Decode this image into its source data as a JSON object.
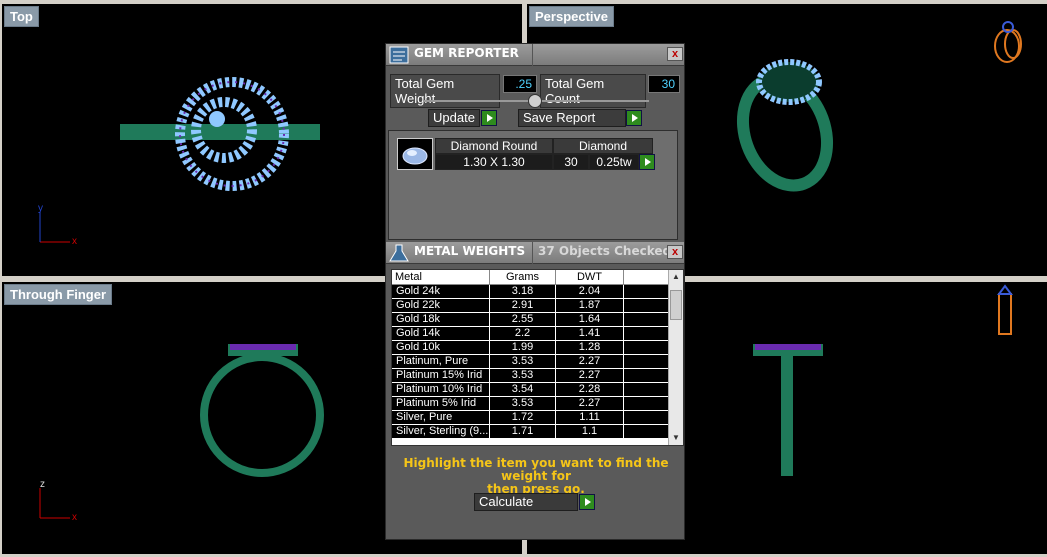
{
  "viewports": {
    "top": {
      "label": "Top"
    },
    "perspective": {
      "label": "Perspective"
    },
    "through_finger": {
      "label": "Through Finger"
    }
  },
  "gem_reporter": {
    "title": "GEM REPORTER",
    "close": "x",
    "total_weight_label": "Total Gem Weight",
    "total_weight_value": ".25",
    "total_count_label": "Total Gem Count",
    "total_count_value": "30",
    "update_label": "Update",
    "save_report_label": "Save Report",
    "gem": {
      "cut": "Diamond Round",
      "size": "1.30 X 1.30",
      "type": "Diamond",
      "count": "30",
      "weight": "0.25tw"
    }
  },
  "metal_weights": {
    "title": "METAL WEIGHTS",
    "status": "37 Objects Checked",
    "close": "x",
    "columns": [
      "Metal",
      "Grams",
      "DWT"
    ],
    "rows": [
      [
        "Gold 24k",
        "3.18",
        "2.04"
      ],
      [
        "Gold 22k",
        "2.91",
        "1.87"
      ],
      [
        "Gold 18k",
        "2.55",
        "1.64"
      ],
      [
        "Gold 14k",
        "2.2",
        "1.41"
      ],
      [
        "Gold 10k",
        "1.99",
        "1.28"
      ],
      [
        "Platinum, Pure",
        "3.53",
        "2.27"
      ],
      [
        "Platinum 15% Irid",
        "3.53",
        "2.27"
      ],
      [
        "Platinum 10% Irid",
        "3.54",
        "2.28"
      ],
      [
        "Platinum 5% Irid",
        "3.53",
        "2.27"
      ],
      [
        "Silver, Pure",
        "1.72",
        "1.11"
      ],
      [
        "Silver, Sterling (9...",
        "1.71",
        "1.1"
      ]
    ],
    "hint_line1": "Highlight the item you want to find the weight for",
    "hint_line2": "then press go.",
    "calculate_label": "Calculate"
  },
  "colors": {
    "ring": "#1f7a5a",
    "gem": "#8fc8ff",
    "prong": "#6a2bb0"
  }
}
